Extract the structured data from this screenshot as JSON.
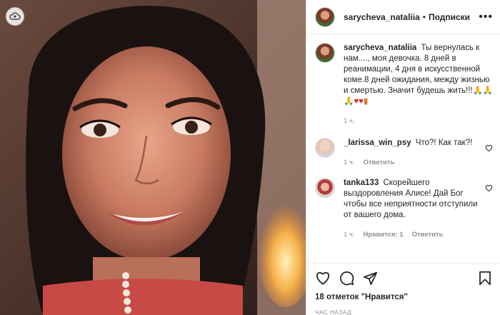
{
  "post": {
    "username": "sarycheva_nataliia",
    "separator": "•",
    "follow_label": "Подписки",
    "caption": "Ты вернулась к нам...., моя девочка. 8 дней в реанимации, 4 дня в искусственной коме.8 дней ожидания, между жизнью и смертью. Значит будешь жить!!!",
    "caption_time": "1 ч."
  },
  "comments": [
    {
      "username": "_larissa_win_psy",
      "text": "Что?! Как так?!",
      "time": "1 ч.",
      "reply_label": "Ответить"
    },
    {
      "username": "tanka133",
      "text": "Скорейшего выздоровления Алисе! Дай Бог чтобы все неприятности отступили от вашего дома.",
      "time": "1 ч.",
      "likes_label": "Нравится: 1",
      "reply_label": "Ответить"
    }
  ],
  "actions": {
    "likes_text": "18 отметок \"Нравится\"",
    "time_ago": "ЧАС НАЗАД"
  },
  "icons": {
    "cloud": "cloud-upload-icon",
    "heart": "heart-icon",
    "comment": "comment-icon",
    "share": "share-icon",
    "save": "bookmark-icon",
    "more": "more-options-icon"
  },
  "colors": {
    "accent_text": "#262626",
    "muted": "#8e8e8e",
    "border": "#efefef"
  }
}
